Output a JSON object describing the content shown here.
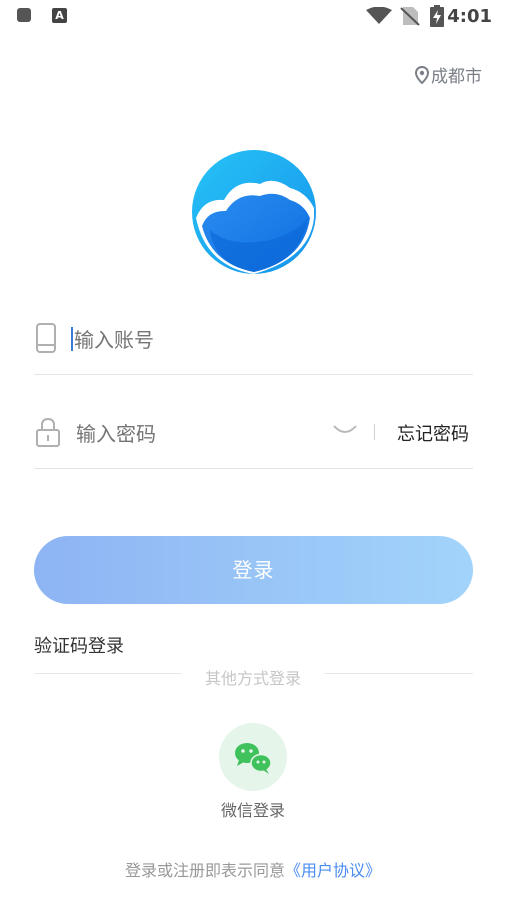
{
  "status_bar": {
    "time": "4:01",
    "app_badge_letter": "A"
  },
  "location": {
    "city": "成都市"
  },
  "account_field": {
    "placeholder": "输入账号"
  },
  "password_field": {
    "placeholder": "输入密码",
    "forgot_label": "忘记密码"
  },
  "login_button": {
    "label": "登录"
  },
  "sms_login": {
    "label": "验证码登录"
  },
  "other_methods": {
    "label": "其他方式登录"
  },
  "wechat": {
    "label": "微信登录"
  },
  "agreement": {
    "prefix": "登录或注册即表示同意",
    "link_text": "《用户协议》"
  },
  "colors": {
    "accent": "#4a8cf0",
    "button_start": "#8eb4f4",
    "button_end": "#a2d4fb",
    "wechat_green": "#3fc15c"
  }
}
